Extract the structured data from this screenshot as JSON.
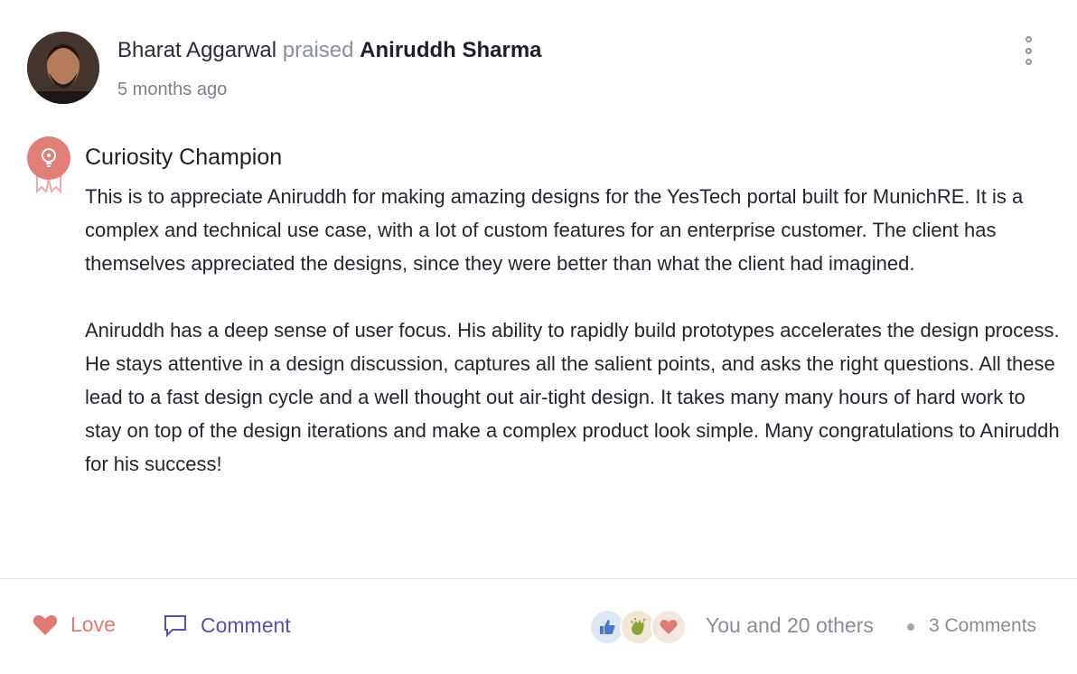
{
  "post": {
    "author": "Bharat Aggarwal",
    "verb": "praised",
    "recipient": "Aniruddh Sharma",
    "timestamp": "5 months ago",
    "award": "Curiosity Champion",
    "paragraphs": [
      "This is to appreciate Aniruddh for making amazing designs for the YesTech portal built for MunichRE. It is a complex and technical use case, with a lot of custom features for an enterprise customer. The client has themselves appreciated the designs, since they were better than what the client had imagined.",
      "Aniruddh has a deep sense of user focus. His ability to rapidly build prototypes accelerates the design process. He stays attentive in a design discussion, captures all the salient points, and asks the right questions. All these lead to a fast design cycle and a well thought out air-tight design. It takes many many hours of hard work to stay on top of the design iterations and make a complex product look simple. Many congratulations to Aniruddh for his success!"
    ]
  },
  "footer": {
    "love_label": "Love",
    "comment_label": "Comment",
    "reactions_summary": "You and 20 others",
    "comments_count": "3 Comments"
  },
  "icons": {
    "more": "more-vertical-icon",
    "badge": "ribbon-award-icon",
    "love": "heart-icon",
    "comment": "speech-bubble-icon",
    "reactions": [
      "thumbs-up-icon",
      "clap-icon",
      "heart-icon"
    ]
  },
  "colors": {
    "badge": "#e27e78",
    "love": "#e07a74",
    "comment": "#5a4fb0",
    "muted": "#888d96"
  }
}
